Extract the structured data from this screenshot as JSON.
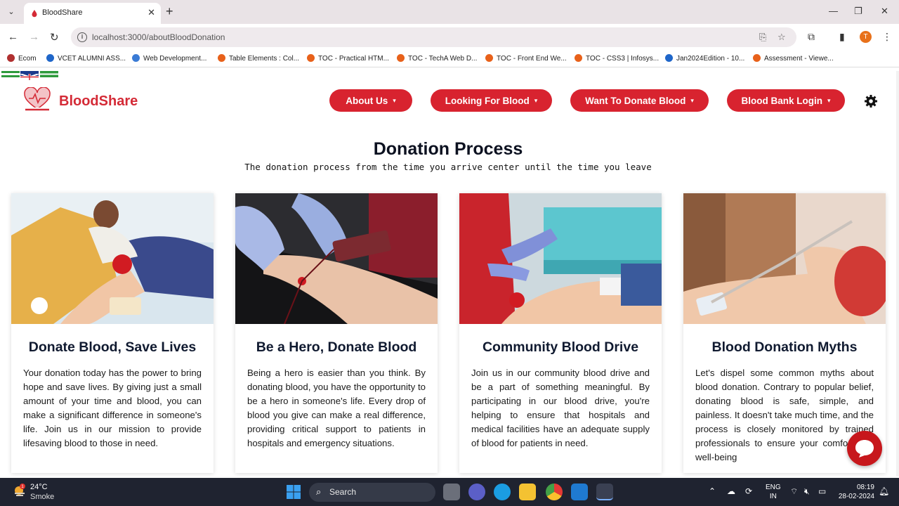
{
  "browser": {
    "tab_title": "BloodShare",
    "new_tab": "+",
    "url": "localhost:3000/aboutBloodDonation",
    "profile_initial": "T",
    "bookmarks": [
      {
        "label": "Ecom",
        "color": "#b03030"
      },
      {
        "label": "VCET ALUMNI ASS...",
        "color": "#1f66c9"
      },
      {
        "label": "Web Development...",
        "color": "#3a7bd5"
      },
      {
        "label": "Table Elements : Col...",
        "color": "#e8611a"
      },
      {
        "label": "TOC - Practical HTM...",
        "color": "#e8611a"
      },
      {
        "label": "TOC - TechA Web D...",
        "color": "#e8611a"
      },
      {
        "label": "TOC - Front End We...",
        "color": "#e8611a"
      },
      {
        "label": "TOC - CSS3 | Infosys...",
        "color": "#e8611a"
      },
      {
        "label": "Jan2024Edition - 10...",
        "color": "#1f66c9"
      },
      {
        "label": "Assessment - Viewe...",
        "color": "#e8611a"
      }
    ]
  },
  "header": {
    "brand": "BloodShare",
    "nav": [
      {
        "label": "About Us"
      },
      {
        "label": "Looking For Blood"
      },
      {
        "label": "Want To Donate Blood"
      },
      {
        "label": "Blood Bank Login"
      }
    ]
  },
  "section": {
    "title": "Donation Process",
    "subtitle": "The donation process from the time you arrive center until the time you leave"
  },
  "cards": [
    {
      "title": "Donate Blood, Save Lives",
      "text": "Your donation today has the power to bring hope and save lives. By giving just a small amount of your time and blood, you can make a significant difference in someone's life. Join us in our mission to provide lifesaving blood to those in need."
    },
    {
      "title": "Be a Hero, Donate Blood",
      "text": "Being a hero is easier than you think. By donating blood, you have the opportunity to be a hero in someone's life. Every drop of blood you give can make a real difference, providing critical support to patients in hospitals and emergency situations."
    },
    {
      "title": "Community Blood Drive",
      "text": "Join us in our community blood drive and be a part of something meaningful. By participating in our blood drive, you're helping to ensure that hospitals and medical facilities have an adequate supply of blood for patients in need."
    },
    {
      "title": "Blood Donation Myths",
      "text": "Let's dispel some common myths about blood donation. Contrary to popular belief, donating blood is safe, simple, and painless. It doesn't take much time, and the process is closely monitored by trained professionals to ensure your comfort and well-being"
    }
  ],
  "taskbar": {
    "weather_temp": "24°C",
    "weather_desc": "Smoke",
    "weather_badge": "1",
    "search_label": "Search",
    "lang_line1": "ENG",
    "lang_line2": "IN",
    "time": "08:19",
    "date": "28-02-2024"
  },
  "colors": {
    "accent": "#d8232f",
    "brand": "#d42a36",
    "taskbar": "#1f2330"
  }
}
